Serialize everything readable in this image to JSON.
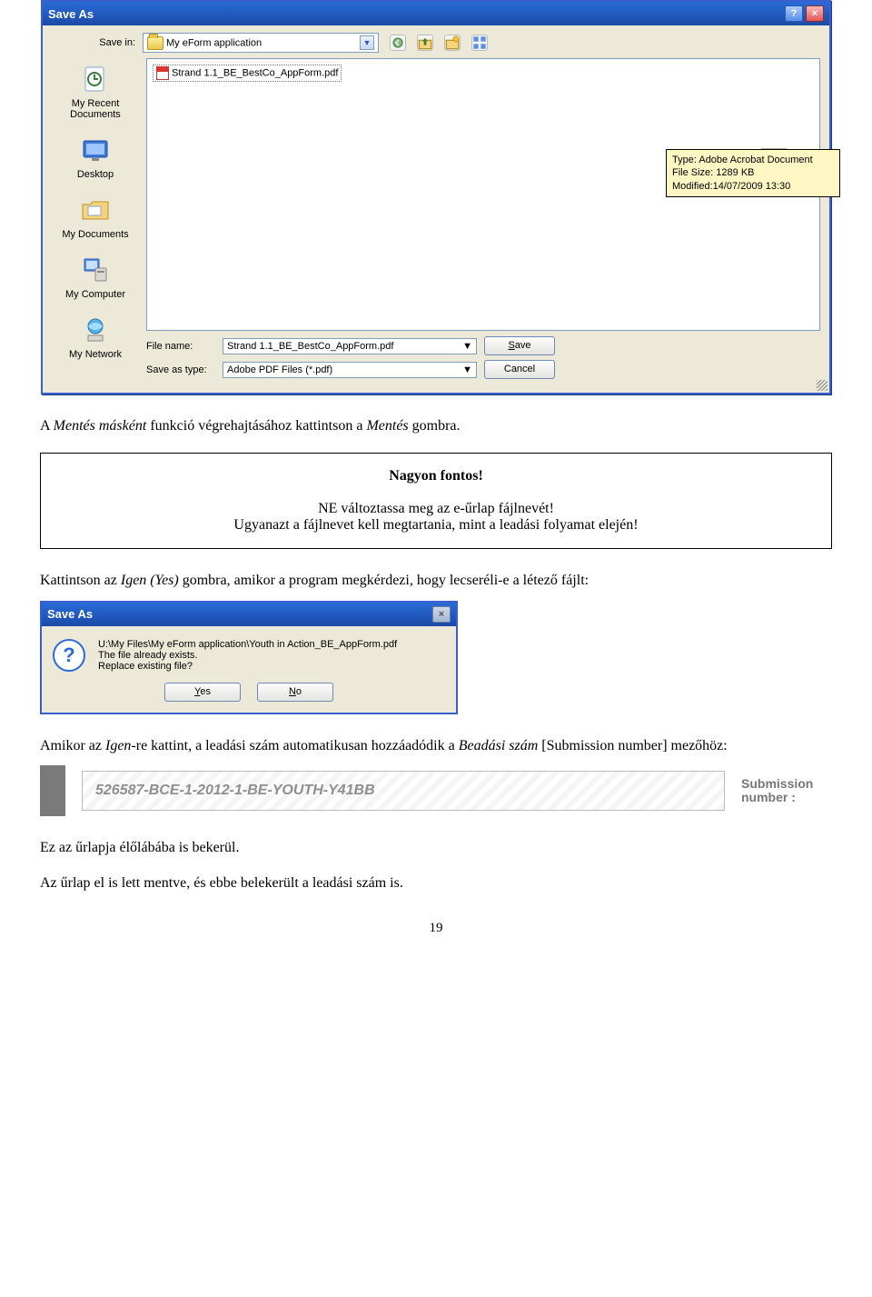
{
  "save_as_dialog": {
    "title": "Save As",
    "save_in_label": "Save in:",
    "save_in_value": "My eForm application",
    "file_in_list": "Strand 1.1_BE_BestCo_AppForm.pdf",
    "tooltip": {
      "line1": "Type: Adobe Acrobat Document",
      "line2": "File Size: 1289 KB",
      "line3": "Modified:14/07/2009 13:30"
    },
    "file_name_label": "File name:",
    "file_name_value": "Strand 1.1_BE_BestCo_AppForm.pdf",
    "save_type_label": "Save as type:",
    "save_type_value": "Adobe PDF Files (*.pdf)",
    "save_btn": "Save",
    "cancel_btn": "Cancel",
    "nav": {
      "recent": "My Recent Documents",
      "desktop": "Desktop",
      "mydocs": "My Documents",
      "mycomputer": "My Computer",
      "mynetwork": "My Network"
    }
  },
  "doc": {
    "p1_a": "A ",
    "p1_b": "Mentés másként",
    "p1_c": " funkció végrehajtásához kattintson a ",
    "p1_d": "Mentés",
    "p1_e": " gombra.",
    "notice_title": "Nagyon fontos!",
    "notice_l1": "NE változtassa meg az e-űrlap fájlnevét!",
    "notice_l2": "Ugyanazt a fájlnevet kell megtartania, mint a leadási folyamat elején!",
    "p2_a": "Kattintson az ",
    "p2_b": "Igen (Yes)",
    "p2_c": " gombra, amikor a program megkérdezi, hogy lecseréli-e a létező fájlt:",
    "p3_a": "Amikor az ",
    "p3_b": "Igen",
    "p3_c": "-re kattint, a leadási szám automatikusan hozzáadódik a ",
    "p3_d": "Beadási szám",
    "p3_e": " [Submission number] mezőhöz:",
    "p4": "Ez az űrlapja élőlábába is bekerül.",
    "p5": "Az űrlap el is lett mentve, és ebbe belekerült a leadási szám is.",
    "page_num": "19"
  },
  "confirm_dialog": {
    "title": "Save As",
    "line1": "U:\\My Files\\My eForm application\\Youth in Action_BE_AppForm.pdf",
    "line2": "The file already exists.",
    "line3": "Replace existing file?",
    "yes": "Yes",
    "no": "No"
  },
  "submission": {
    "value": "526587-BCE-1-2012-1-BE-YOUTH-Y41BB",
    "label1": "Submission",
    "label2": "number :"
  }
}
